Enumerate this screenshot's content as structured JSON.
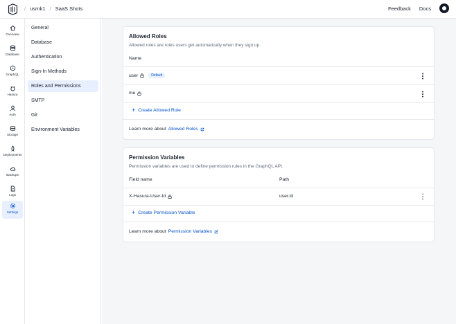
{
  "header": {
    "crumbs": [
      "usrnk1",
      "SaaS Shots"
    ],
    "separator": "/",
    "feedback": "Feedback",
    "docs": "Docs"
  },
  "rail": {
    "items": [
      {
        "label": "Overview",
        "icon": "home-icon"
      },
      {
        "label": "Database",
        "icon": "database-icon"
      },
      {
        "label": "GraphQL",
        "icon": "graphql-icon"
      },
      {
        "label": "Hasura",
        "icon": "hasura-icon"
      },
      {
        "label": "Auth",
        "icon": "user-icon"
      },
      {
        "label": "Storage",
        "icon": "storage-icon"
      },
      {
        "label": "Deployments",
        "icon": "rocket-icon"
      },
      {
        "label": "Backups",
        "icon": "cloud-icon"
      },
      {
        "label": "Logs",
        "icon": "file-icon"
      },
      {
        "label": "Settings",
        "icon": "gear-icon"
      }
    ],
    "active": "Settings"
  },
  "subnav": {
    "items": [
      "General",
      "Database",
      "Authentication",
      "Sign-In Methods",
      "Roles and Permissions",
      "SMTP",
      "Git",
      "Environment Variables"
    ],
    "active": "Roles and Permissions"
  },
  "allowed_roles": {
    "title": "Allowed Roles",
    "description": "Allowed roles are roles users get automatically when they sign up.",
    "column": "Name",
    "rows": [
      {
        "name": "user",
        "badge": "Default"
      },
      {
        "name": "me",
        "badge": ""
      }
    ],
    "add_label": "Create Allowed Role",
    "learn_prefix": "Learn more about",
    "learn_link": "Allowed Roles"
  },
  "permission_variables": {
    "title": "Permission Variables",
    "description": "Permission variables are used to define permission rules in the GraphQL API.",
    "columns": [
      "Field name",
      "Path"
    ],
    "rows": [
      {
        "field": "X-Hasura-User-Id",
        "path": "user.id"
      }
    ],
    "add_label": "Create Permission Variable",
    "learn_prefix": "Learn more about",
    "learn_link": "Permission Variables"
  },
  "colors": {
    "accent": "#0052cd",
    "active_bg": "#e8efff"
  }
}
